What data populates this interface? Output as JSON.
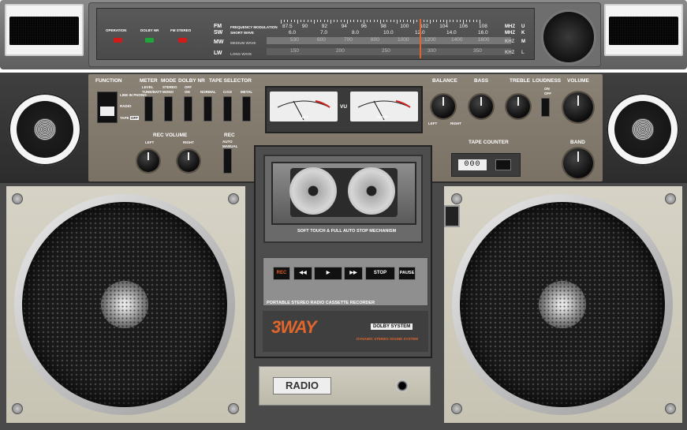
{
  "tuner": {
    "operation_label": "OPERATION",
    "dolby_nr_label": "DOLBY NR",
    "fm_stereo_label": "FM STEREO",
    "fm_label": "FM",
    "sw_label": "SW",
    "mw_label": "MW",
    "lw_label": "LW",
    "fm_desc": "FREQUENCY MODULATION",
    "sw_desc": "SHORT WAVE",
    "mw_desc": "MEDIUM WAVE",
    "lw_desc": "LONG WAVE",
    "fm_scale": [
      "87.5",
      "90",
      "92",
      "94",
      "96",
      "98",
      "100",
      "102",
      "104",
      "106",
      "108"
    ],
    "sw_scale": [
      "6.0",
      "7.0",
      "8.0",
      "10.0",
      "12.0",
      "14.0",
      "16.0"
    ],
    "mw_scale": [
      "530",
      "600",
      "700",
      "800",
      "1000",
      "1200",
      "1400",
      "1600"
    ],
    "lw_scale": [
      "150",
      "200",
      "250",
      "300",
      "350"
    ],
    "units_fm": "MHZ",
    "units_sw": "MHZ",
    "units_mw": "KHZ",
    "units_lw": "KHZ",
    "band_fm": "U",
    "band_sw": "K",
    "band_mw": "M",
    "band_lw": "L",
    "led_colors": [
      "#d11a1a",
      "#1fa53a",
      "#d11a1a"
    ]
  },
  "controls": {
    "function_label": "FUNCTION",
    "function_opts": [
      "LINE IN PHONO",
      "RADIO",
      "TAPE"
    ],
    "function_tape_tag": "OFF",
    "meter_label": "METER",
    "meter_opts": [
      "LEVEL",
      "TUNE/BATT"
    ],
    "mode_label": "MODE",
    "mode_opts": [
      "STEREO",
      "MONO"
    ],
    "dolby_label": "DOLBY NR",
    "dolby_opts": [
      "OFF",
      "ON"
    ],
    "tape_selector_label": "TAPE SELECTOR",
    "tape_selector_opts": [
      "NORMAL",
      "CrO2",
      "METAL"
    ],
    "vu_label": "VU",
    "vu_left": "LEFT",
    "vu_right": "RIGHT",
    "balance_label": "BALANCE",
    "balance_left": "LEFT",
    "balance_right": "RIGHT",
    "bass_label": "BASS",
    "treble_label": "TREBLE",
    "loudness_label": "LOUDNESS",
    "loudness_opts": [
      "ON",
      "OFF"
    ],
    "volume_label": "VOLUME",
    "rec_volume_label": "REC VOLUME",
    "rec_left": "LEFT",
    "rec_right": "RIGHT",
    "rec_label": "REC",
    "rec_opts": [
      "AUTO",
      "MANUAL"
    ],
    "tape_counter_label": "TAPE COUNTER",
    "tape_counter_value": "000",
    "band_label": "BAND"
  },
  "deck": {
    "mechanism_text": "SOFT TOUCH & FULL AUTO STOP MECHANISM",
    "buttons": [
      "REC",
      "◀◀",
      "▶",
      "▶▶",
      "STOP",
      "PAUSE"
    ],
    "deck_caption": "PORTABLE  STEREO  RADIO  CASSETTE  RECORDER",
    "brand": "3WAY",
    "dolby_badge": "DOLBY SYSTEM",
    "dynamic_text": "DYNAMIC STEREO SOUND SYSTEM"
  },
  "bottom": {
    "radio_label": "RADIO"
  }
}
